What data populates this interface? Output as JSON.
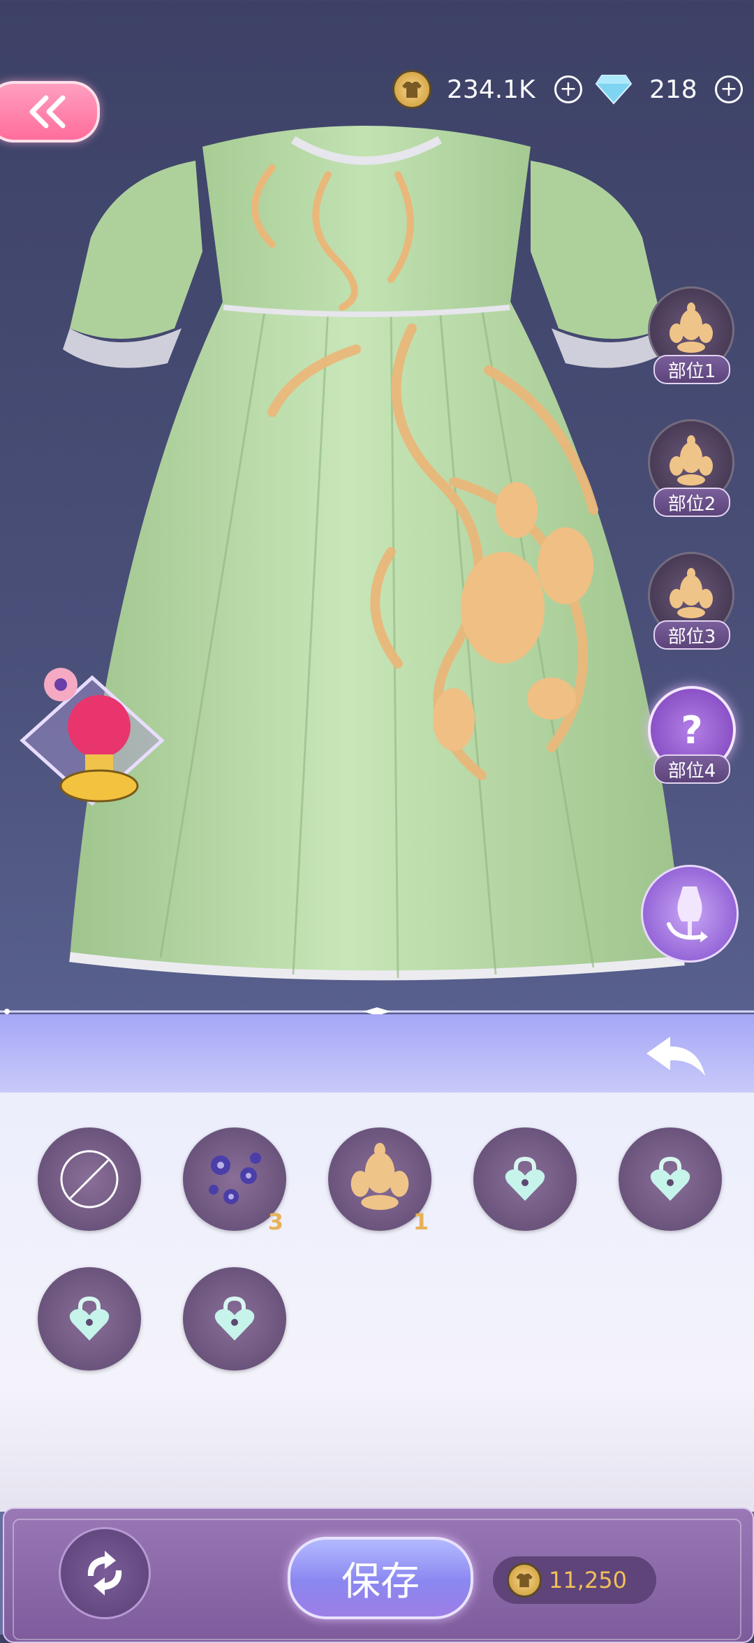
{
  "header": {
    "coins": "234.1K",
    "diamonds": "218"
  },
  "parts": [
    {
      "label": "部位1"
    },
    {
      "label": "部位2"
    },
    {
      "label": "部位3"
    },
    {
      "label": "部位4",
      "symbol": "?"
    }
  ],
  "patterns": [
    {
      "name": "none"
    },
    {
      "name": "blue-floral",
      "count": "3"
    },
    {
      "name": "gold-damask",
      "count": "1"
    },
    {
      "name": "locked-1"
    },
    {
      "name": "locked-2"
    },
    {
      "name": "locked-3"
    },
    {
      "name": "locked-4"
    }
  ],
  "footer": {
    "save_label": "保存",
    "cost": "11,250"
  },
  "colors": {
    "dress": "#b7d9a6",
    "embroidery": "#f0bf84",
    "accent": "#9c7ee6"
  }
}
